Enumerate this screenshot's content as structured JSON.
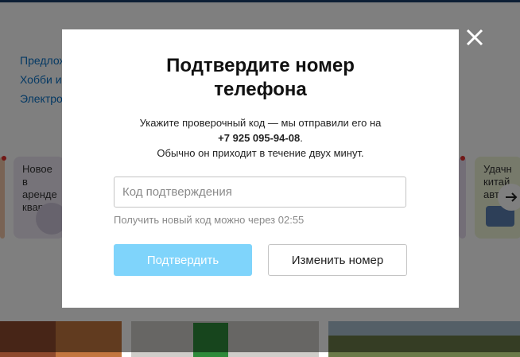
{
  "background": {
    "category_links": [
      "Предлож",
      "Хобби и",
      "Электро"
    ],
    "cards": [
      {
        "text": "Новое\nв аренде\nквартир"
      },
      {
        "text": "Удачн\nкитай\nавт"
      }
    ],
    "next_arrow_icon": "arrow-right-icon"
  },
  "modal": {
    "title_line1": "Подтвердите номер",
    "title_line2": "телефона",
    "desc_line1": "Укажите проверочный код — мы отправили его на",
    "phone": "+7 925 095-94-08",
    "phone_suffix": ".",
    "desc_line3": "Обычно он приходит в течение двух минут.",
    "code_placeholder": "Код подтверждения",
    "code_value": "",
    "resend_hint": "Получить новый код можно через 02:55",
    "confirm_label": "Подтвердить",
    "change_label": "Изменить номер",
    "close_icon": "close-icon"
  },
  "colors": {
    "overlay": "rgba(0,0,0,0.5)",
    "confirm_button": "#7fd4fb",
    "link": "#0a73c8"
  }
}
